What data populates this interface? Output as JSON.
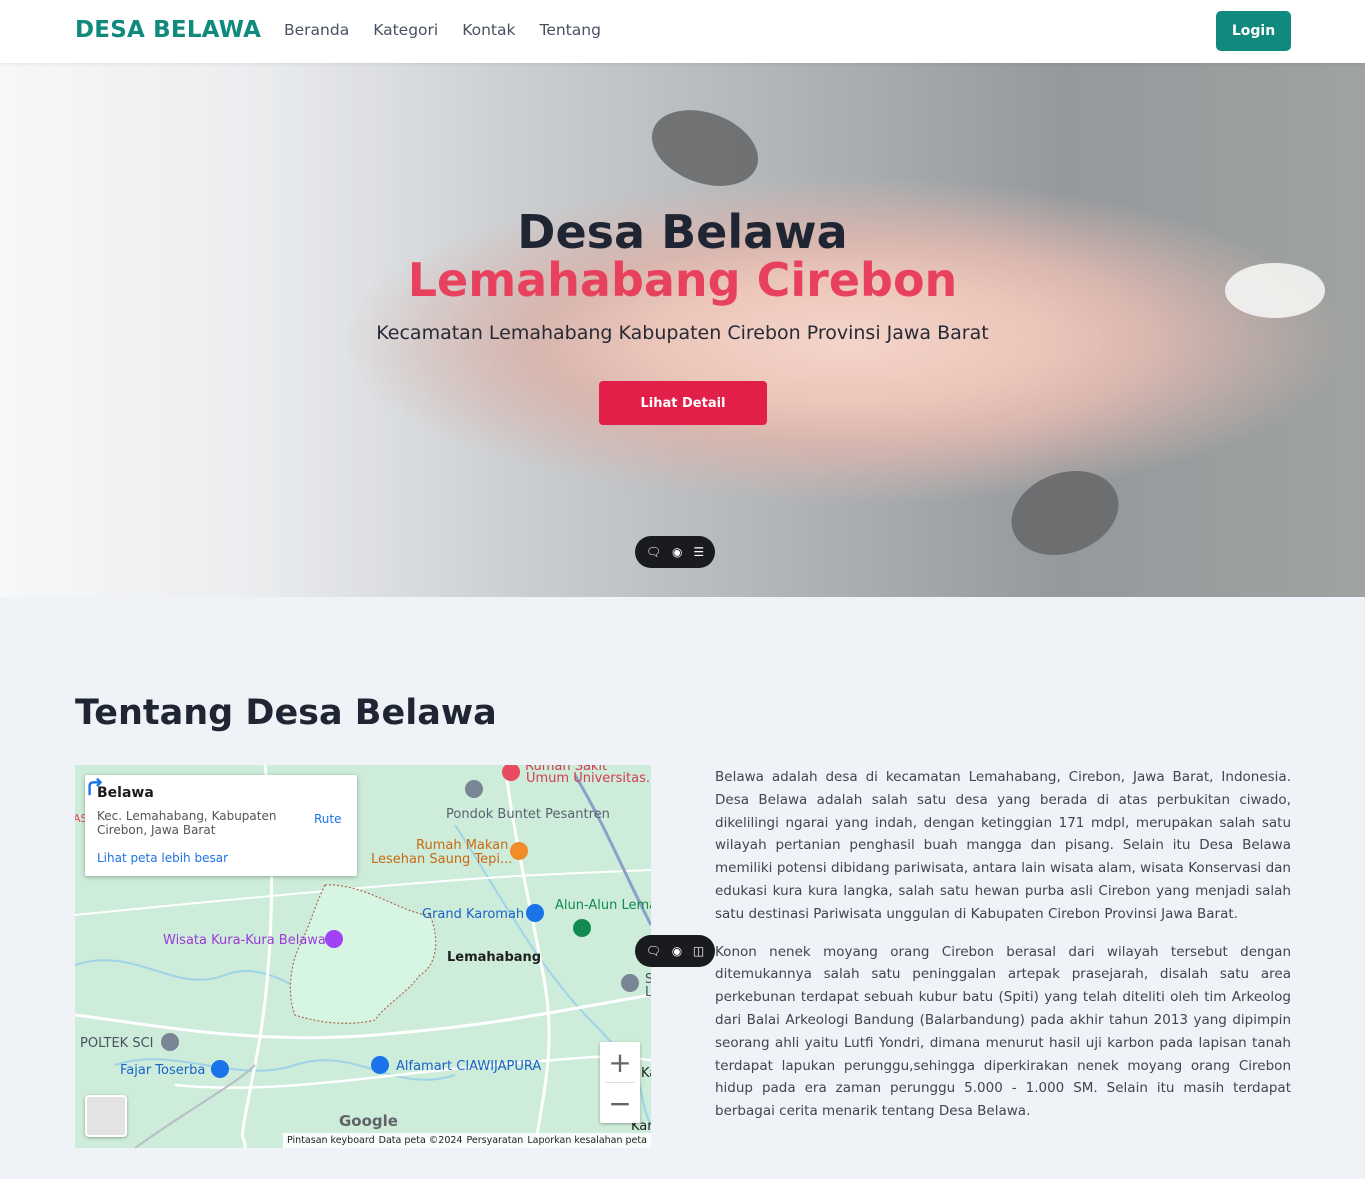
{
  "navbar": {
    "brand": "DESA BELAWA",
    "links": [
      "Beranda",
      "Kategori",
      "Kontak",
      "Tentang"
    ],
    "login_label": "Login"
  },
  "hero": {
    "title": "Desa Belawa",
    "subtitle": "Lemahabang Cirebon",
    "description": "Kecamatan Lemahabang Kabupaten Cirebon Provinsi Jawa Barat",
    "button_label": "Lihat Detail"
  },
  "about": {
    "title": "Tentang Desa Belawa",
    "paragraphs": [
      "Belawa adalah desa di kecamatan Lemahabang, Cirebon, Jawa Barat, Indonesia. Desa Belawa adalah salah satu desa yang berada di atas perbukitan ciwado, dikelilingi ngarai yang indah, dengan ketinggian 171 mdpl, merupakan salah satu wilayah pertanian penghasil buah mangga dan pisang. Selain itu Desa Belawa memiliki potensi dibidang pariwisata, antara lain wisata alam, wisata Konservasi dan edukasi kura kura langka, salah satu hewan purba asli Cirebon yang menjadi salah satu destinasi Pariwisata unggulan di Kabupaten Cirebon Provinsi Jawa Barat.",
      "Konon nenek moyang orang Cirebon berasal dari wilayah tersebut dengan ditemukannya salah satu peninggalan artepak prasejarah, disalah satu area perkebunan terdapat sebuah kubur batu (Spiti) yang telah diteliti oleh tim Arkeolog dari Balai Arkeologi Bandung (Balarbandung) pada akhir tahun 2013 yang dipimpin seorang ahli yaitu Lutfi Yondri, dimana menurut hasil uji karbon pada lapisan tanah terdapat lapukan perunggu,sehingga diperkirakan nenek moyang orang Cirebon hidup pada era zaman perunggu 5.000 - 1.000 SM. Selain itu masih terdapat berbagai cerita menarik tentang Desa Belawa."
    ]
  },
  "map": {
    "card": {
      "title": "Belawa",
      "address": "Kec. Lemahabang, Kabupaten Cirebon, Jawa Barat",
      "route_label": "Rute",
      "larger_map_link": "Lihat peta lebih besar"
    },
    "labels": {
      "rs": "Rumah Sakit",
      "umum": "Umum Universitas...",
      "pondok": "Pondok Buntet Pesantren",
      "rumah_makan_1": "Rumah Makan",
      "rumah_makan_2": "Lesehan Saung Tepi...",
      "grand": "Grand Karomah",
      "alun": "Alun-Alun Lema",
      "wisata": "Wisata Kura-Kura Belawa",
      "lemahabang": "Lemahabang",
      "poltek": "POLTEK SCI",
      "fajar": "Fajar Toserba",
      "alfamart": "Alfamart CIAWIJAPURA",
      "ka1": "Ka",
      "ka2": "Kar",
      "edge_s": "S",
      "edge_l": "L",
      "edge_as": "AS"
    },
    "zoom_in": "+",
    "zoom_out": "−",
    "google": "Google",
    "attribution": [
      "Pintasan keyboard",
      "Data peta ©2024",
      "Persyaratan",
      "Laporkan kesalahan peta"
    ]
  },
  "floating_toolbar": {
    "icons": [
      "comment-icon",
      "eye-icon",
      "list-icon"
    ]
  },
  "colors": {
    "brand": "#0f8a7c",
    "accent": "#e21f48",
    "subtitle": "#e8415e"
  }
}
